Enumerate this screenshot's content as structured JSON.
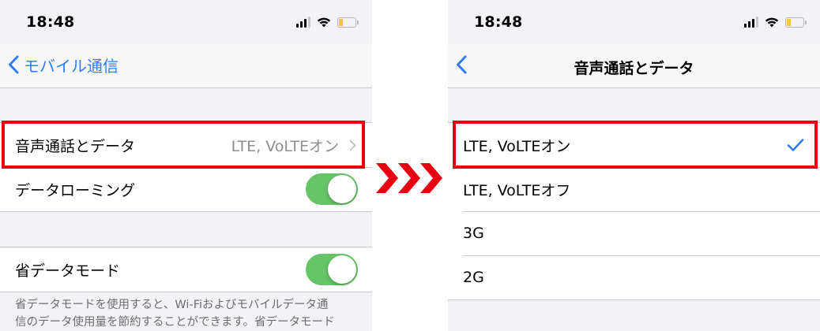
{
  "colors": {
    "accent": "#2f7cf6",
    "toggle_on": "#65c466",
    "highlight": "#e60012",
    "battery_low": "#f7c244"
  },
  "left": {
    "status": {
      "time": "18:48"
    },
    "nav": {
      "back_label": "モバイル通信",
      "back_icon": "chevron-left-icon"
    },
    "voice_data": {
      "label": "音声通話とデータ",
      "value": "LTE, VoLTEオン",
      "icon": "chevron-right-icon"
    },
    "data_roaming": {
      "label": "データローミング",
      "enabled": true
    },
    "low_data_mode": {
      "label": "省データモード",
      "enabled": true
    },
    "footer": {
      "line1": "省データモードを使用すると、Wi-Fiおよびモバイルデータ通",
      "line2": "信のデータ使用量を節約することができます。省データモード"
    }
  },
  "right": {
    "status": {
      "time": "18:48"
    },
    "nav": {
      "title": "音声通話とデータ",
      "back_icon": "chevron-left-icon"
    },
    "options": [
      {
        "label": "LTE, VoLTEオン",
        "selected": true
      },
      {
        "label": "LTE, VoLTEオフ",
        "selected": false
      },
      {
        "label": "3G",
        "selected": false
      },
      {
        "label": "2G",
        "selected": false
      }
    ]
  }
}
